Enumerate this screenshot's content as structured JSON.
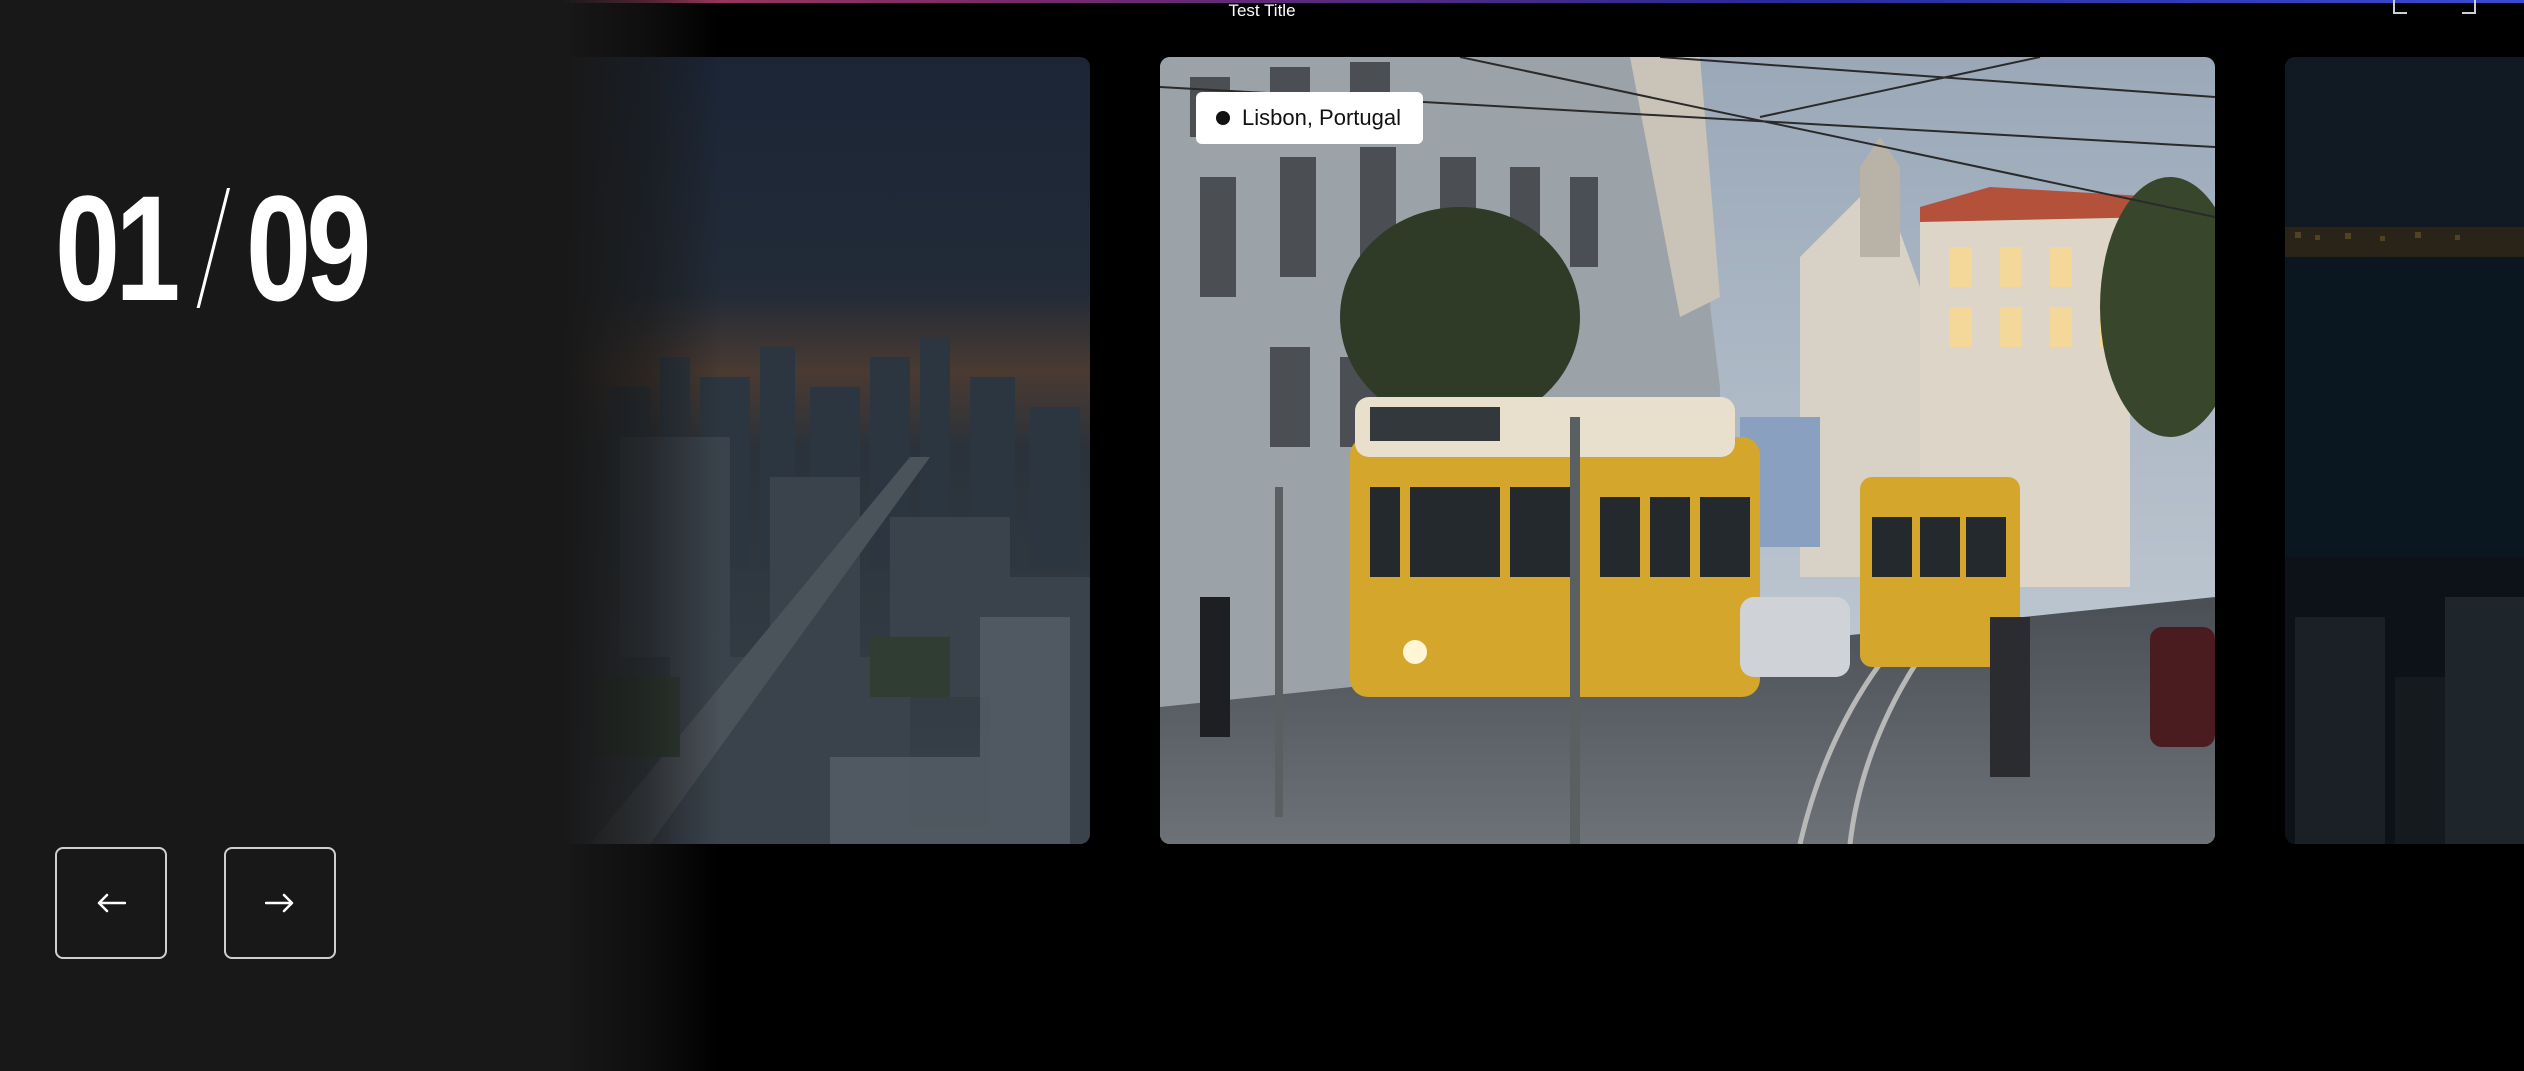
{
  "header": {
    "title": "Test Title"
  },
  "slider": {
    "current": "01",
    "total": "09",
    "prev_icon": "arrow-left-icon",
    "next_icon": "arrow-right-icon"
  },
  "slides": [
    {
      "name": "bangkok-skyline"
    },
    {
      "name": "lisbon-tram",
      "location": "Lisbon, Portugal"
    },
    {
      "name": "city-night"
    }
  ],
  "colors": {
    "background": "#000000",
    "panel": "#181818",
    "chip": "#ffffff",
    "tram": "#d4a72c"
  }
}
